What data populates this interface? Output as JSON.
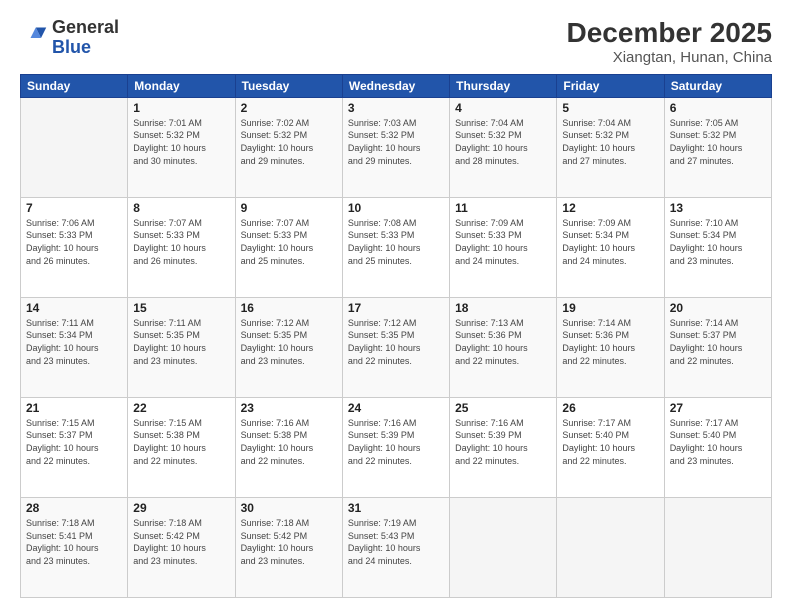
{
  "logo": {
    "general": "General",
    "blue": "Blue"
  },
  "title": "December 2025",
  "subtitle": "Xiangtan, Hunan, China",
  "days_header": [
    "Sunday",
    "Monday",
    "Tuesday",
    "Wednesday",
    "Thursday",
    "Friday",
    "Saturday"
  ],
  "weeks": [
    [
      {
        "day": "",
        "info": ""
      },
      {
        "day": "1",
        "info": "Sunrise: 7:01 AM\nSunset: 5:32 PM\nDaylight: 10 hours\nand 30 minutes."
      },
      {
        "day": "2",
        "info": "Sunrise: 7:02 AM\nSunset: 5:32 PM\nDaylight: 10 hours\nand 29 minutes."
      },
      {
        "day": "3",
        "info": "Sunrise: 7:03 AM\nSunset: 5:32 PM\nDaylight: 10 hours\nand 29 minutes."
      },
      {
        "day": "4",
        "info": "Sunrise: 7:04 AM\nSunset: 5:32 PM\nDaylight: 10 hours\nand 28 minutes."
      },
      {
        "day": "5",
        "info": "Sunrise: 7:04 AM\nSunset: 5:32 PM\nDaylight: 10 hours\nand 27 minutes."
      },
      {
        "day": "6",
        "info": "Sunrise: 7:05 AM\nSunset: 5:32 PM\nDaylight: 10 hours\nand 27 minutes."
      }
    ],
    [
      {
        "day": "7",
        "info": "Sunrise: 7:06 AM\nSunset: 5:33 PM\nDaylight: 10 hours\nand 26 minutes."
      },
      {
        "day": "8",
        "info": "Sunrise: 7:07 AM\nSunset: 5:33 PM\nDaylight: 10 hours\nand 26 minutes."
      },
      {
        "day": "9",
        "info": "Sunrise: 7:07 AM\nSunset: 5:33 PM\nDaylight: 10 hours\nand 25 minutes."
      },
      {
        "day": "10",
        "info": "Sunrise: 7:08 AM\nSunset: 5:33 PM\nDaylight: 10 hours\nand 25 minutes."
      },
      {
        "day": "11",
        "info": "Sunrise: 7:09 AM\nSunset: 5:33 PM\nDaylight: 10 hours\nand 24 minutes."
      },
      {
        "day": "12",
        "info": "Sunrise: 7:09 AM\nSunset: 5:34 PM\nDaylight: 10 hours\nand 24 minutes."
      },
      {
        "day": "13",
        "info": "Sunrise: 7:10 AM\nSunset: 5:34 PM\nDaylight: 10 hours\nand 23 minutes."
      }
    ],
    [
      {
        "day": "14",
        "info": "Sunrise: 7:11 AM\nSunset: 5:34 PM\nDaylight: 10 hours\nand 23 minutes."
      },
      {
        "day": "15",
        "info": "Sunrise: 7:11 AM\nSunset: 5:35 PM\nDaylight: 10 hours\nand 23 minutes."
      },
      {
        "day": "16",
        "info": "Sunrise: 7:12 AM\nSunset: 5:35 PM\nDaylight: 10 hours\nand 23 minutes."
      },
      {
        "day": "17",
        "info": "Sunrise: 7:12 AM\nSunset: 5:35 PM\nDaylight: 10 hours\nand 22 minutes."
      },
      {
        "day": "18",
        "info": "Sunrise: 7:13 AM\nSunset: 5:36 PM\nDaylight: 10 hours\nand 22 minutes."
      },
      {
        "day": "19",
        "info": "Sunrise: 7:14 AM\nSunset: 5:36 PM\nDaylight: 10 hours\nand 22 minutes."
      },
      {
        "day": "20",
        "info": "Sunrise: 7:14 AM\nSunset: 5:37 PM\nDaylight: 10 hours\nand 22 minutes."
      }
    ],
    [
      {
        "day": "21",
        "info": "Sunrise: 7:15 AM\nSunset: 5:37 PM\nDaylight: 10 hours\nand 22 minutes."
      },
      {
        "day": "22",
        "info": "Sunrise: 7:15 AM\nSunset: 5:38 PM\nDaylight: 10 hours\nand 22 minutes."
      },
      {
        "day": "23",
        "info": "Sunrise: 7:16 AM\nSunset: 5:38 PM\nDaylight: 10 hours\nand 22 minutes."
      },
      {
        "day": "24",
        "info": "Sunrise: 7:16 AM\nSunset: 5:39 PM\nDaylight: 10 hours\nand 22 minutes."
      },
      {
        "day": "25",
        "info": "Sunrise: 7:16 AM\nSunset: 5:39 PM\nDaylight: 10 hours\nand 22 minutes."
      },
      {
        "day": "26",
        "info": "Sunrise: 7:17 AM\nSunset: 5:40 PM\nDaylight: 10 hours\nand 22 minutes."
      },
      {
        "day": "27",
        "info": "Sunrise: 7:17 AM\nSunset: 5:40 PM\nDaylight: 10 hours\nand 23 minutes."
      }
    ],
    [
      {
        "day": "28",
        "info": "Sunrise: 7:18 AM\nSunset: 5:41 PM\nDaylight: 10 hours\nand 23 minutes."
      },
      {
        "day": "29",
        "info": "Sunrise: 7:18 AM\nSunset: 5:42 PM\nDaylight: 10 hours\nand 23 minutes."
      },
      {
        "day": "30",
        "info": "Sunrise: 7:18 AM\nSunset: 5:42 PM\nDaylight: 10 hours\nand 23 minutes."
      },
      {
        "day": "31",
        "info": "Sunrise: 7:19 AM\nSunset: 5:43 PM\nDaylight: 10 hours\nand 24 minutes."
      },
      {
        "day": "",
        "info": ""
      },
      {
        "day": "",
        "info": ""
      },
      {
        "day": "",
        "info": ""
      }
    ]
  ]
}
